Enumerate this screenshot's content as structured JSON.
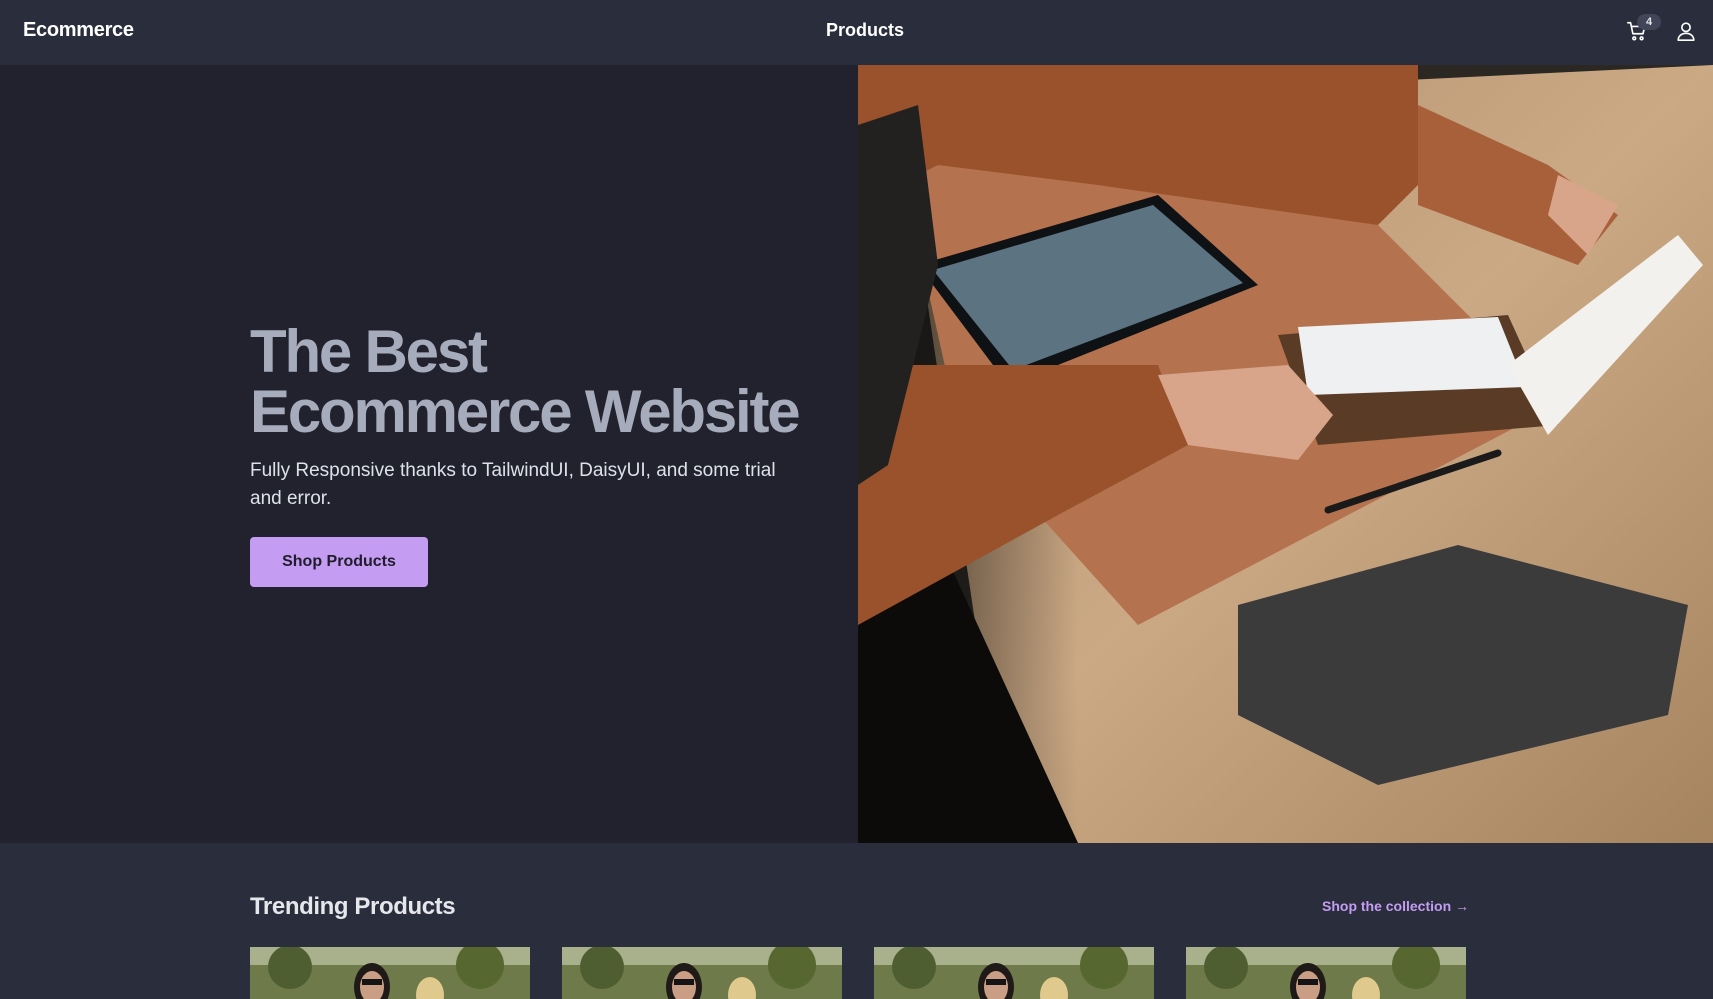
{
  "navbar": {
    "brand": "Ecommerce",
    "center_link": "Products",
    "cart_count": "4"
  },
  "hero": {
    "title_line1": "The Best",
    "title_line2": "Ecommerce Website",
    "subtitle": "Fully Responsive thanks to TailwindUI, DaisyUI, and some trial and error.",
    "button_label": "Shop Products"
  },
  "trending": {
    "title": "Trending Products",
    "link_label": "Shop the collection →",
    "cards": [
      {
        "image": "product-photo"
      },
      {
        "image": "product-photo"
      },
      {
        "image": "product-photo"
      },
      {
        "image": "product-photo"
      }
    ]
  },
  "colors": {
    "navbar_bg": "#2a2d3c",
    "hero_bg": "#21222e",
    "accent": "#c49cf2",
    "title_text": "#a6acbb"
  }
}
